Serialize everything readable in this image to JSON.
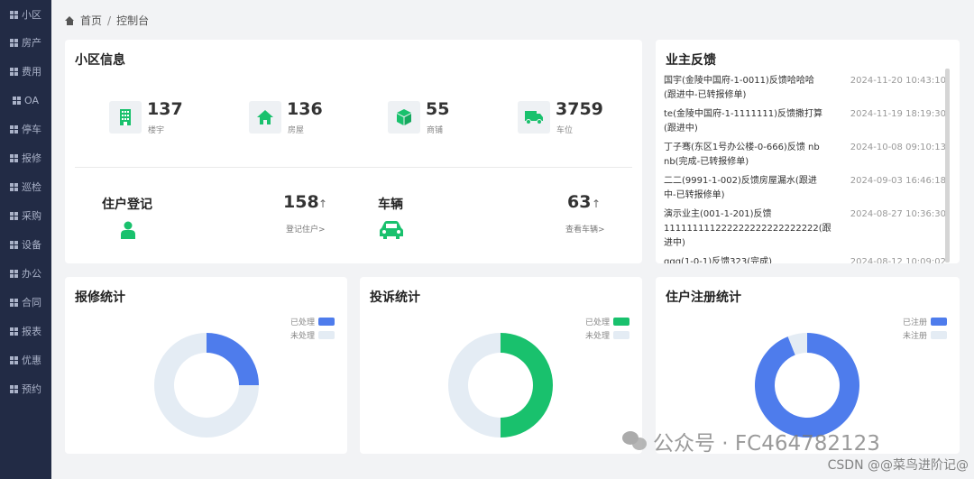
{
  "sidebar": {
    "items": [
      {
        "label": "小区"
      },
      {
        "label": "房产"
      },
      {
        "label": "费用"
      },
      {
        "label": "OA"
      },
      {
        "label": "停车"
      },
      {
        "label": "报修"
      },
      {
        "label": "巡检"
      },
      {
        "label": "采购"
      },
      {
        "label": "设备"
      },
      {
        "label": "办公"
      },
      {
        "label": "合同"
      },
      {
        "label": "报表"
      },
      {
        "label": "优惠"
      },
      {
        "label": "预约"
      }
    ]
  },
  "breadcrumb": {
    "home": "首页",
    "separator": "/",
    "current": "控制台"
  },
  "info": {
    "title": "小区信息",
    "stats": [
      {
        "value": "137",
        "label": "楼宇",
        "icon": "building-icon"
      },
      {
        "value": "136",
        "label": "房屋",
        "icon": "house-icon"
      },
      {
        "value": "55",
        "label": "商铺",
        "icon": "box-icon"
      },
      {
        "value": "3759",
        "label": "车位",
        "icon": "truck-icon"
      }
    ],
    "residents": {
      "title": "住户登记",
      "count": "158",
      "link": "登记住户>",
      "arrow": "↑"
    },
    "vehicles": {
      "title": "车辆",
      "count": "63",
      "link": "查看车辆>",
      "arrow": "↑"
    }
  },
  "feedback": {
    "title": "业主反馈",
    "items": [
      {
        "text": "国宇(金陵中国府-1-0011)反馈哈哈哈(跟进中-已转报修单)",
        "date": "2024-11-20 10:43:10"
      },
      {
        "text": "te(金陵中国府-1-1111111)反馈撒打算(跟进中)",
        "date": "2024-11-19 18:19:30"
      },
      {
        "text": "丁子骞(东区1号办公楼-0-666)反馈 nb nb(完成-已转报修单)",
        "date": "2024-10-08 09:10:13"
      },
      {
        "text": "二二(9991-1-002)反馈房屋漏水(跟进中-已转报修单)",
        "date": "2024-09-03 16:46:18"
      },
      {
        "text": "演示业主(001-1-201)反馈111111111222222222222222222(跟进中)",
        "date": "2024-08-27 10:36:30"
      },
      {
        "text": "qqq(1-0-1)反馈323(完成)",
        "date": "2024-08-12 10:09:02"
      }
    ]
  },
  "charts": [
    {
      "title": "报修统计",
      "legend": [
        "已处理",
        "未处理"
      ],
      "colors": [
        "#4e7cec",
        "#e4ecf4"
      ],
      "chart_data": {
        "type": "pie",
        "categories": [
          "已处理",
          "未处理"
        ],
        "values": [
          25,
          75
        ]
      }
    },
    {
      "title": "投诉统计",
      "legend": [
        "已处理",
        "未处理"
      ],
      "colors": [
        "#19c16d",
        "#e4ecf4"
      ],
      "chart_data": {
        "type": "pie",
        "categories": [
          "已处理",
          "未处理"
        ],
        "values": [
          50,
          50
        ]
      }
    },
    {
      "title": "住户注册统计",
      "legend": [
        "已注册",
        "未注册"
      ],
      "colors": [
        "#4e7cec",
        "#e4ecf4"
      ],
      "chart_data": {
        "type": "pie",
        "categories": [
          "已注册",
          "未注册"
        ],
        "values": [
          94,
          6
        ]
      }
    }
  ],
  "watermark": {
    "text": "公众号 · FC464782123",
    "csdn": "CSDN @@菜鸟进阶记@"
  }
}
